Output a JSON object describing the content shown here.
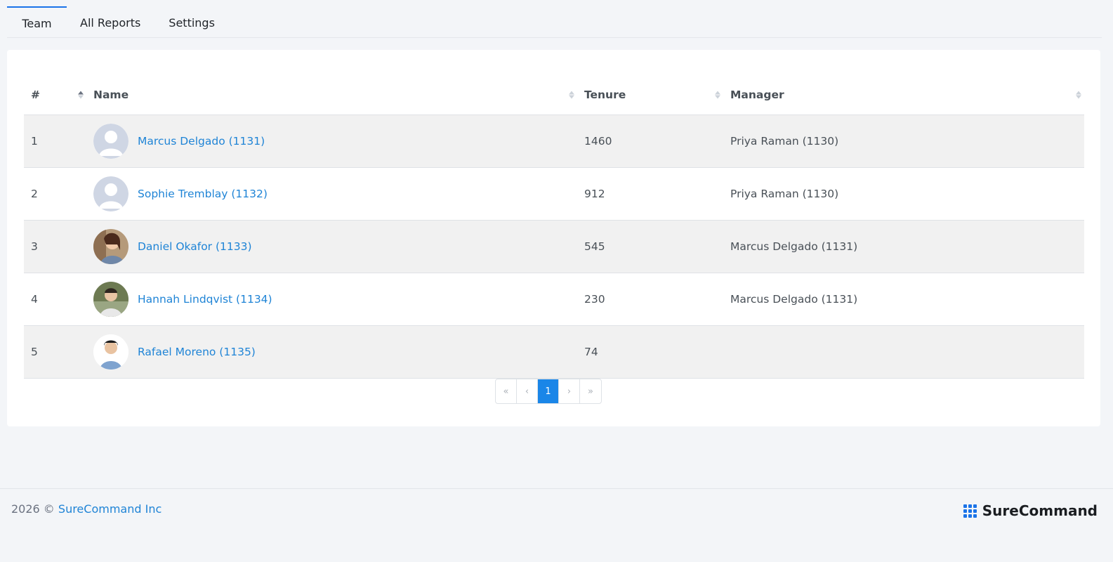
{
  "tabs": [
    {
      "label": "Team",
      "active": true
    },
    {
      "label": "All Reports",
      "active": false
    },
    {
      "label": "Settings",
      "active": false
    }
  ],
  "table": {
    "columns": [
      "#",
      "Name",
      "Tenure",
      "Manager"
    ],
    "rows": [
      {
        "num": "1",
        "name": "Marcus Delgado (1131)",
        "tenure": "1460",
        "manager": "Priya Raman (1130)",
        "avatar": "placeholder"
      },
      {
        "num": "2",
        "name": "Sophie Tremblay (1132)",
        "tenure": "912",
        "manager": "Priya Raman (1130)",
        "avatar": "placeholder"
      },
      {
        "num": "3",
        "name": "Daniel Okafor (1133)",
        "tenure": "545",
        "manager": "Marcus Delgado (1131)",
        "avatar": "photo"
      },
      {
        "num": "4",
        "name": "Hannah Lindqvist (1134)",
        "tenure": "230",
        "manager": "Marcus Delgado (1131)",
        "avatar": "photo"
      },
      {
        "num": "5",
        "name": "Rafael Moreno (1135)",
        "tenure": "74",
        "manager": "",
        "avatar": "photo"
      }
    ]
  },
  "pagination": {
    "first": "«",
    "prev": "‹",
    "current": "1",
    "next": "›",
    "last": "»"
  },
  "footer": {
    "copyright": "2026 ©",
    "company_link": "SureCommand Inc",
    "brand": "SureCommand"
  },
  "colors": {
    "accent": "#1a86e8",
    "link": "#1f84d6"
  }
}
